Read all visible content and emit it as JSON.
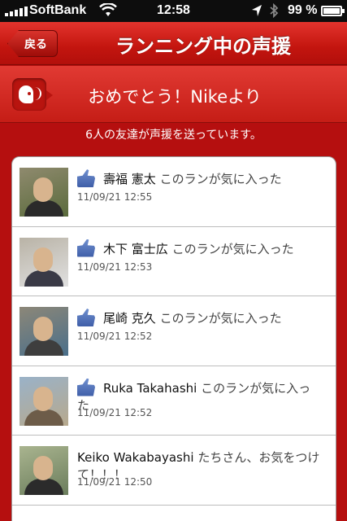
{
  "status_bar": {
    "carrier": "SoftBank",
    "time": "12:58",
    "battery": "99 %",
    "battery_level": 0.99
  },
  "nav": {
    "back_label": "戻る",
    "title": "ランニング中の声援"
  },
  "banner": {
    "message": "おめでとう！Nikeより"
  },
  "summary": "6人の友達が声援を送っています。",
  "entries": [
    {
      "name": "壽福 憲太",
      "message": "このランが気に入った",
      "time": "11/09/21  12:55",
      "liked": true
    },
    {
      "name": "木下 富士広",
      "message": "このランが気に入った",
      "time": "11/09/21  12:53",
      "liked": true
    },
    {
      "name": "尾崎 克久",
      "message": "このランが気に入った",
      "time": "11/09/21  12:52",
      "liked": true
    },
    {
      "name": "Ruka Takahashi",
      "message": "このランが気に入った",
      "time": "11/09/21  12:52",
      "liked": true
    },
    {
      "name": "Keiko Wakabayashi",
      "message": "たちさん、お気をつけて！！！",
      "time": "11/09/21  12:50",
      "liked": false
    }
  ]
}
